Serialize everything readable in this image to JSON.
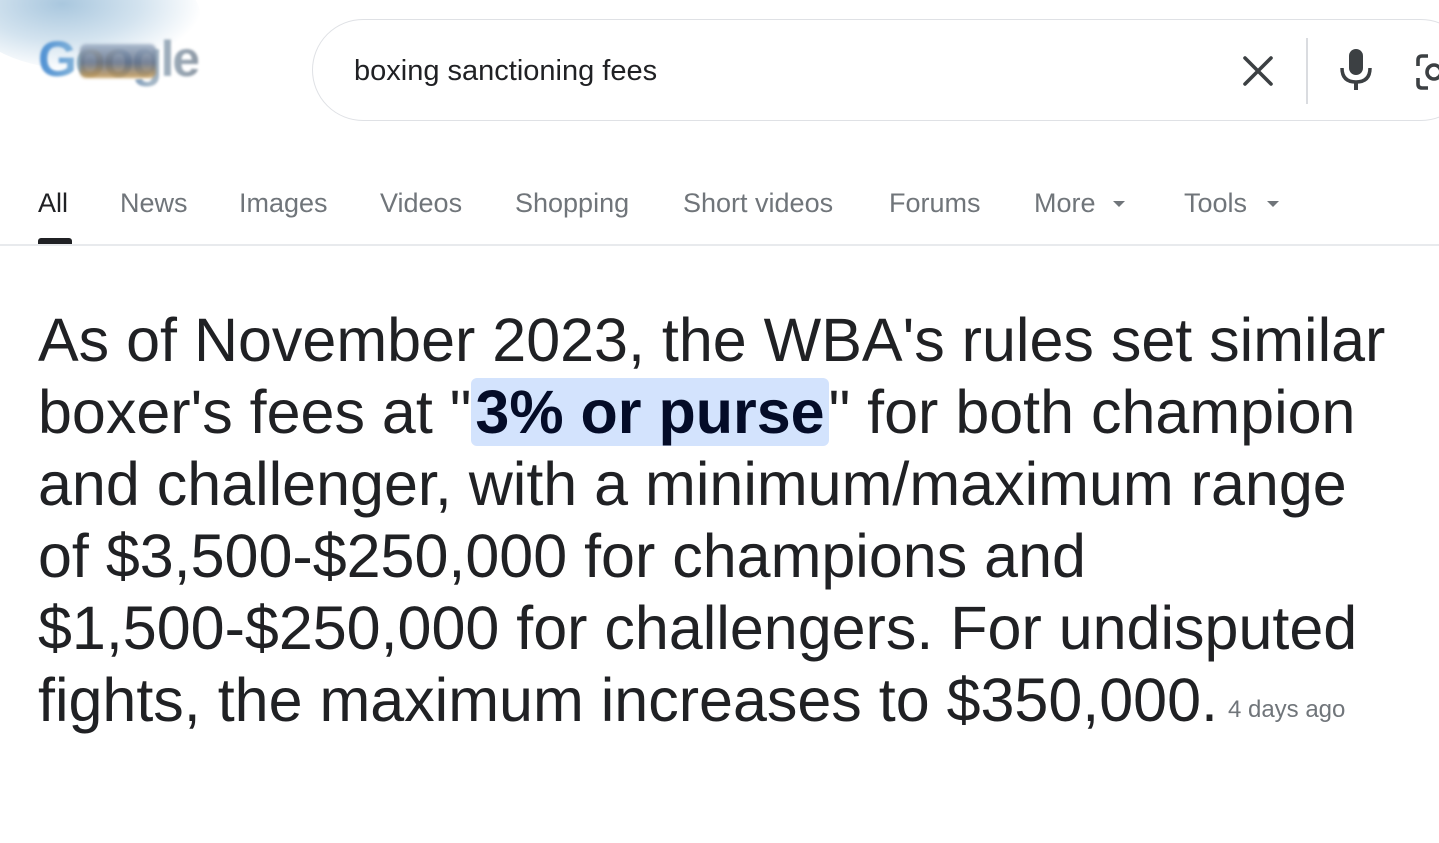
{
  "logo": {
    "text": "Google"
  },
  "search": {
    "query": "boxing sanctioning fees",
    "clear_icon": "close-icon",
    "voice_icon": "microphone-icon",
    "lens_icon": "camera-lens-icon"
  },
  "tabs": [
    {
      "label": "All",
      "active": true
    },
    {
      "label": "News"
    },
    {
      "label": "Images"
    },
    {
      "label": "Videos"
    },
    {
      "label": "Shopping"
    },
    {
      "label": "Short videos"
    },
    {
      "label": "Forums"
    },
    {
      "label": "More",
      "icon": "caret-down-icon"
    },
    {
      "label": "Tools",
      "icon": "caret-down-icon"
    }
  ],
  "answer": {
    "before": "As of November 2023, the WBA's rules set similar boxer's fees at \"",
    "highlight": "3% or purse",
    "after": "\" for both champion and challenger, with a minimum/maximum range of $3,500-$250,000 for champions and $1,500-$250,000 for challengers. For undisputed fights, the maximum increases to $350,000.",
    "date": "4 days ago"
  },
  "colors": {
    "highlight_bg": "#d3e3fd",
    "text": "#202124",
    "muted": "#70757a",
    "border": "#dfe1e5"
  }
}
